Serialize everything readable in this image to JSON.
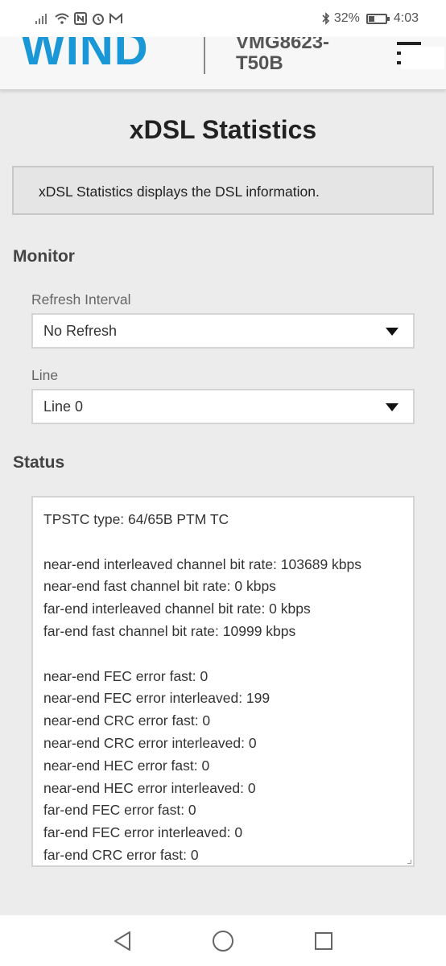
{
  "status_bar": {
    "battery": "32%",
    "time": "4:03",
    "icons": [
      "signal-icon",
      "wifi-icon",
      "nfc-icon",
      "alarm-icon",
      "gmail-icon",
      "bluetooth-icon",
      "battery-icon"
    ]
  },
  "header": {
    "logo": "WIND",
    "model_line1": "VMG8623-",
    "model_line2": "T50B",
    "menu_icon": "hamburger-menu-icon",
    "brand_color": "#1a97d6"
  },
  "page": {
    "title": "xDSL Statistics",
    "description": "xDSL Statistics displays the DSL information."
  },
  "monitor": {
    "title": "Monitor",
    "refresh_label": "Refresh Interval",
    "refresh_value": "No Refresh",
    "line_label": "Line",
    "line_value": "Line 0"
  },
  "status": {
    "title": "Status",
    "lines": [
      "TPSTC type: 64/65B PTM TC",
      "",
      "near-end interleaved channel bit rate: 103689 kbps",
      "near-end fast channel bit rate: 0 kbps",
      "far-end interleaved channel bit rate: 0 kbps",
      "far-end fast channel bit rate: 10999 kbps",
      "",
      "near-end FEC error fast: 0",
      "near-end FEC error interleaved: 199",
      "near-end CRC error fast: 0",
      "near-end CRC error interleaved: 0",
      "near-end HEC error fast: 0",
      "near-end HEC error interleaved: 0",
      "far-end FEC error fast: 0",
      "far-end FEC error interleaved: 0",
      "far-end CRC error fast: 0"
    ]
  },
  "nav": {
    "back": "back-icon",
    "home": "home-icon",
    "recents": "recents-icon"
  }
}
